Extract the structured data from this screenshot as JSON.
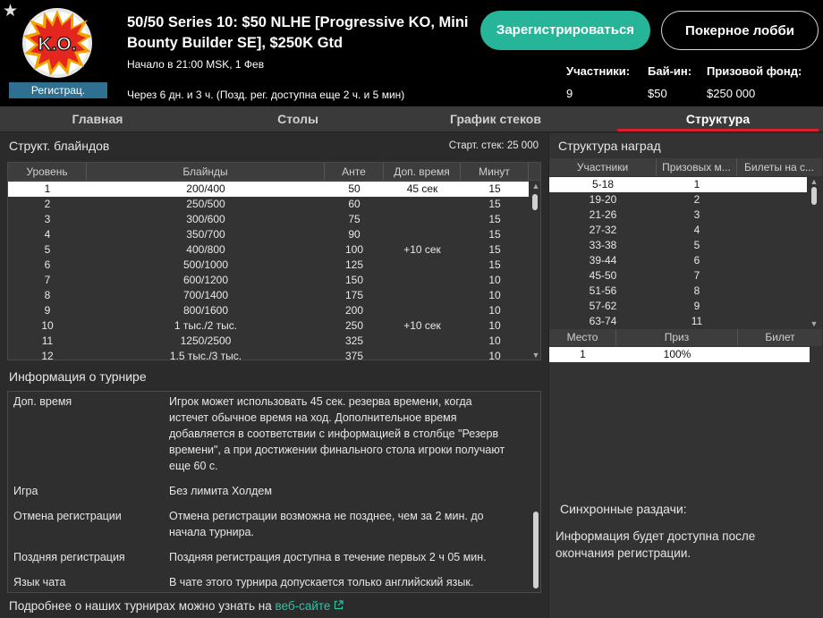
{
  "header": {
    "logo_text": "K.O.",
    "registration_badge": "Регистрац.",
    "title": "50/50 Series 10: $50 NLHE [Progressive KO, Mini Bounty Builder SE], $250K Gtd",
    "start_time": "Начало в 21:00 MSK, 1 Фев",
    "late_reg": "Через 6 дн. и 3 ч. (Позд. рег. доступна еще 2 ч. и 5 мин)",
    "register_button": "Зарегистрироваться",
    "lobby_button": "Покерное лобби",
    "participants_label": "Участники:",
    "participants_value": "9",
    "buyin_label": "Бай-ин:",
    "buyin_value": "$50",
    "prize_label": "Призовой фонд:",
    "prize_value": "$250 000"
  },
  "tabs": [
    "Главная",
    "Столы",
    "График стеков",
    "Структура"
  ],
  "active_tab": "Структура",
  "blinds": {
    "title": "Структ. блайндов",
    "start_stack": "Старт. стек: 25 000",
    "columns": [
      "Уровень",
      "Блайнды",
      "Анте",
      "Доп. время",
      "Минут"
    ],
    "rows": [
      [
        "1",
        "200/400",
        "50",
        "45 сек",
        "15"
      ],
      [
        "2",
        "250/500",
        "60",
        "",
        "15"
      ],
      [
        "3",
        "300/600",
        "75",
        "",
        "15"
      ],
      [
        "4",
        "350/700",
        "90",
        "",
        "15"
      ],
      [
        "5",
        "400/800",
        "100",
        "+10 сек",
        "15"
      ],
      [
        "6",
        "500/1000",
        "125",
        "",
        "15"
      ],
      [
        "7",
        "600/1200",
        "150",
        "",
        "10"
      ],
      [
        "8",
        "700/1400",
        "175",
        "",
        "10"
      ],
      [
        "9",
        "800/1600",
        "200",
        "",
        "10"
      ],
      [
        "10",
        "1 тыс./2 тыс.",
        "250",
        "+10 сек",
        "10"
      ],
      [
        "11",
        "1250/2500",
        "325",
        "",
        "10"
      ],
      [
        "12",
        "1,5 тыс./3 тыс.",
        "375",
        "",
        "10"
      ]
    ]
  },
  "info": {
    "title": "Информация о турнире",
    "rows": [
      {
        "key": "Доп. время",
        "value": "Игрок может использовать 45 сек. резерва времени, когда истечет обычное время на ход. Дополнительное время добавляется в соответствии с информацией в столбце \"Резерв времени\", а при достижении финального стола игроки получают еще 60 с."
      },
      {
        "key": "Игра",
        "value": "Без лимита Холдем"
      },
      {
        "key": "Отмена регистрации",
        "value": "Отмена регистрации возможна не позднее, чем за 2 мин. до начала турнира."
      },
      {
        "key": "Поздняя регистрация",
        "value": "Поздняя регистрация доступна в течение первых 2 ч 05 мин."
      },
      {
        "key": "Язык чата",
        "value": "В чате этого турнира допускается только английский язык."
      }
    ],
    "more_text": "Подробнее о наших турнирах можно узнать на",
    "more_link": "веб-сайте"
  },
  "prizes": {
    "title": "Структура наград",
    "columns": [
      "Участники",
      "Призовых м...",
      "Билеты на с..."
    ],
    "rows": [
      [
        "5-18",
        "1",
        ""
      ],
      [
        "19-20",
        "2",
        ""
      ],
      [
        "21-26",
        "3",
        ""
      ],
      [
        "27-32",
        "4",
        ""
      ],
      [
        "33-38",
        "5",
        ""
      ],
      [
        "39-44",
        "6",
        ""
      ],
      [
        "45-50",
        "7",
        ""
      ],
      [
        "51-56",
        "8",
        ""
      ],
      [
        "57-62",
        "9",
        ""
      ],
      [
        "63-74",
        "11",
        ""
      ]
    ],
    "place_columns": [
      "Место",
      "Приз",
      "Билет"
    ],
    "place_rows": [
      [
        "1",
        "100%",
        ""
      ]
    ],
    "sync_title": "Синхронные раздачи:",
    "sync_text": "Информация будет доступна после окончания регистрации."
  }
}
